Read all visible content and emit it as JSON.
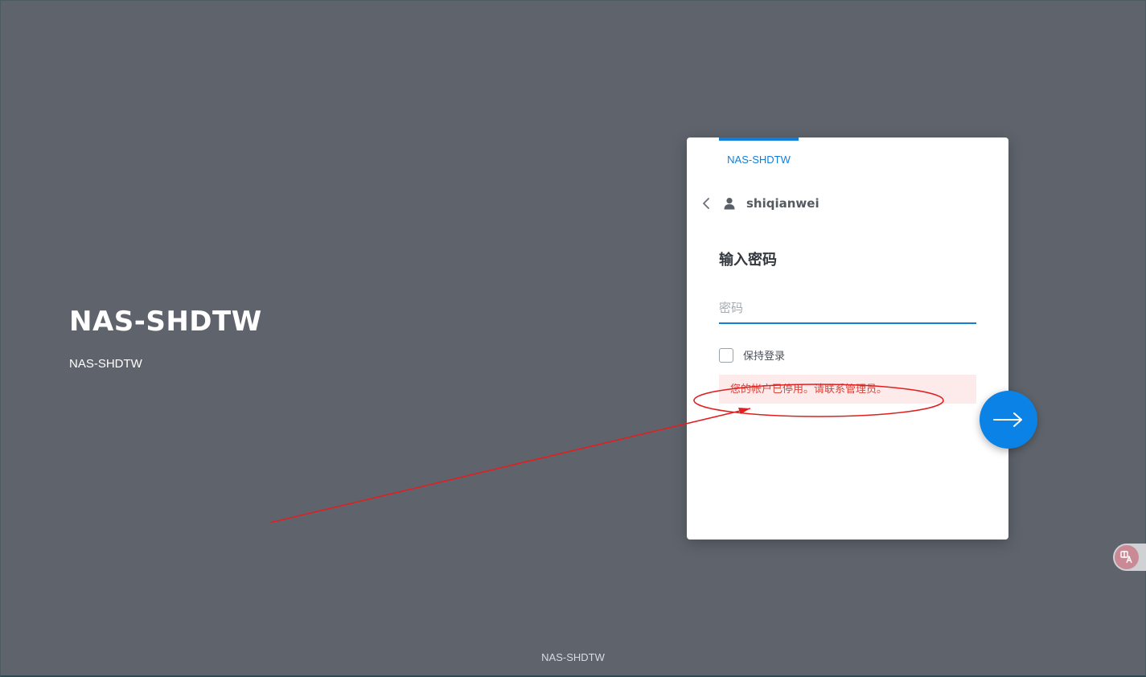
{
  "brand": {
    "title": "NAS-SHDTW",
    "subtitle": "NAS-SHDTW"
  },
  "login": {
    "tab_label": "NAS-SHDTW",
    "username": "shiqianwei",
    "heading": "输入密码",
    "password_placeholder": "密码",
    "password_value": "",
    "remember_label": "保持登录",
    "remember_checked": false,
    "error_message": "您的帐户已停用。请联系管理员。"
  },
  "footer": {
    "text": "NAS-SHDTW"
  },
  "icons": {
    "back": "chevron-left-icon",
    "user": "user-icon",
    "submit": "arrow-right-icon",
    "translate": "translate-icon"
  },
  "colors": {
    "background": "#5f646c",
    "accent": "#0f7fdc",
    "submit_button": "#0b83e6",
    "error_text": "#d8463d",
    "error_bg": "#fdeaea",
    "annotation": "#e02020"
  }
}
